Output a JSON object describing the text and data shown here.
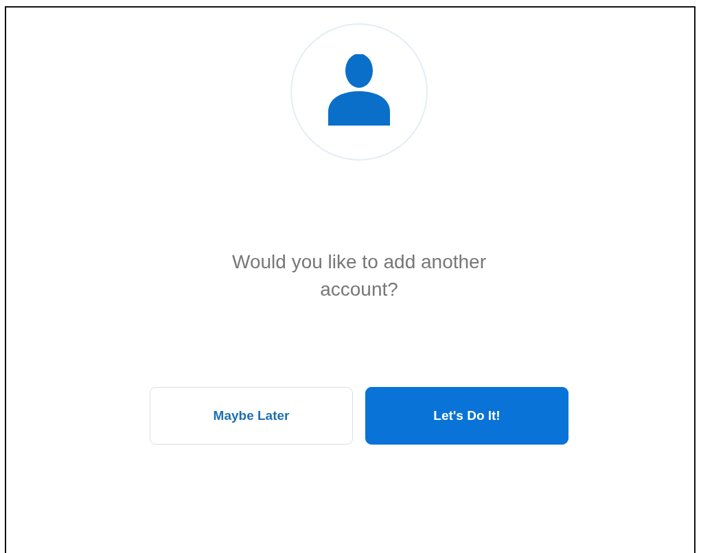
{
  "prompt": {
    "question": "Would you like to add another account?"
  },
  "buttons": [
    {
      "label": "Maybe Later",
      "kind": "secondary"
    },
    {
      "label": "Let's Do It!",
      "kind": "primary"
    }
  ]
}
